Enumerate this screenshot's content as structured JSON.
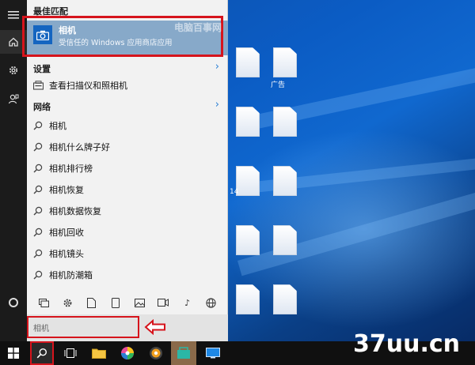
{
  "start_menu": {
    "best_match_header": "最佳匹配",
    "best_match": {
      "title": "相机",
      "subtitle": "受信任的 Windows 应用商店应用"
    },
    "settings_header": "设置",
    "settings_items": [
      {
        "label": "查看扫描仪和照相机",
        "icon": "scanner-camera-icon"
      }
    ],
    "web_header": "网络",
    "web_items": [
      {
        "label": "相机"
      },
      {
        "label": "相机什么牌子好"
      },
      {
        "label": "相机排行榜"
      },
      {
        "label": "相机恢复"
      },
      {
        "label": "相机数据恢复"
      },
      {
        "label": "相机回收"
      },
      {
        "label": "相机镜头"
      },
      {
        "label": "相机防潮箱"
      }
    ],
    "filter_icons": [
      "apps-icon",
      "settings-icon",
      "document-icon",
      "tablet-icon",
      "photos-icon",
      "video-icon",
      "music-icon",
      "web-icon"
    ]
  },
  "search": {
    "value": "相机"
  },
  "watermarks": {
    "top": "电脑百事网",
    "bottom": "37uu.cn"
  },
  "desktop": {
    "labels": [
      "14",
      "广告"
    ]
  },
  "colors": {
    "highlight_border": "#d6141c",
    "best_match_bg": "#87a9c9",
    "accent": "#2a7fd4",
    "taskbar": "#101010"
  }
}
